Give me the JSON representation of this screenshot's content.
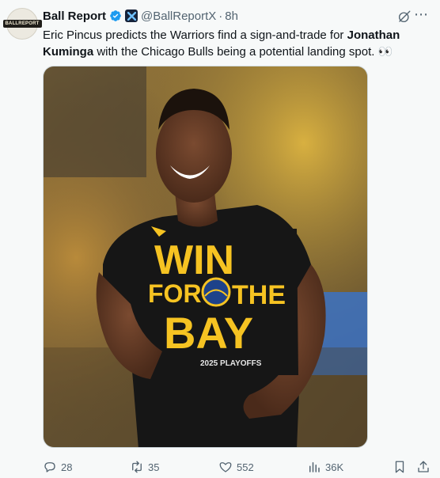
{
  "post": {
    "author_name": "Ball Report",
    "handle": "@BallReportX",
    "separator": "·",
    "time": "8h",
    "avatar_text": "BALLREPORT",
    "text_parts": {
      "t1": "Eric Pincus predicts the Warriors find a sign-and-trade for ",
      "bold": "Jonathan Kuminga",
      "t2": " with the Chicago Bulls being a potential landing spot. ",
      "emoji": "👀"
    },
    "media": {
      "shirt_lines": [
        "WIN",
        "FOR",
        "THE",
        "BAY"
      ],
      "shirt_footer": "2025 PLAYOFFS"
    }
  },
  "actions": {
    "replies": "28",
    "reposts": "35",
    "likes": "552",
    "views": "36K"
  },
  "colors": {
    "secondary_text": "#536471",
    "verified": "#1d9bf0",
    "shirt": "#1a1a1a",
    "shirt_print": "#f6c322",
    "warriors_blue": "#1d428a"
  }
}
